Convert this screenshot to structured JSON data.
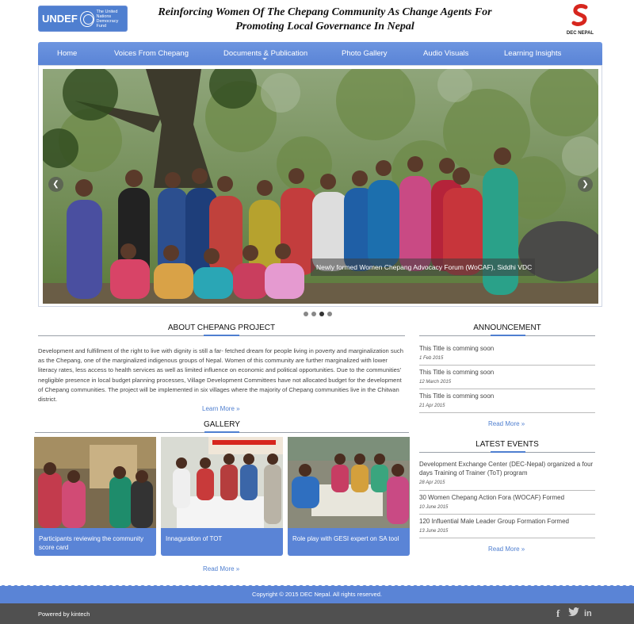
{
  "header": {
    "undef_logo_text": "UNDEF",
    "undef_logo_sub": "The United Nations Democracy Fund",
    "title_line1": "Reinforcing Women Of The Chepang Community As Change Agents For",
    "title_line2": "Promoting Local Governance In Nepal",
    "dec_logo_label": "DEC NEPAL"
  },
  "nav": {
    "items": [
      {
        "label": "Home"
      },
      {
        "label": "Voices From Chepang"
      },
      {
        "label": "Documents & Publication"
      },
      {
        "label": "Photo Gallery"
      },
      {
        "label": "Audio Visuals"
      },
      {
        "label": "Learning Insights"
      }
    ]
  },
  "slider": {
    "caption": "Newly formed Women Chepang Advocacy Forum (WoCAF), Siddhi VDC",
    "prev_icon": "chevron-left-icon",
    "next_icon": "chevron-right-icon",
    "active_dot": 3,
    "dot_count": 4
  },
  "about": {
    "heading": "ABOUT CHEPANG PROJECT",
    "body": "Development and fulfillment of the right to live with dignity is still a far- fetched dream for people living in poverty and marginalization such as the Chepang, one of the marginalized indigenous groups of Nepal. Women of this community are further marginalized with lower literacy rates, less access to health services as well as limited influence on economic and political opportunities. Due to the communities' negligible presence in local budget planning processes, Village Development Committees have not allocated budget for the development of Chepang communities. The project will be implemented in six villages where the majority of Chepang communities live in the Chitwan district.",
    "read_more": "Learn More »"
  },
  "gallery": {
    "heading": "GALLERY",
    "items": [
      {
        "caption": "Participants reviewing the community score card"
      },
      {
        "caption": "Innaguration of TOT"
      },
      {
        "caption": "Role play with GESI expert on SA tool"
      }
    ],
    "read_more": "Read More »"
  },
  "announcement": {
    "heading": "ANNOUNCEMENT",
    "items": [
      {
        "title": "This Title is comming soon",
        "date": "1 Feb 2015"
      },
      {
        "title": "This Title is comming soon",
        "date": "12 March 2015"
      },
      {
        "title": "This Title is comming soon",
        "date": "21 Apr 2015"
      }
    ],
    "read_more": "Read More »"
  },
  "events": {
    "heading": "LATEST EVENTS",
    "items": [
      {
        "title": "Development Exchange Center (DEC-Nepal) organized a four days Training of Trainer (ToT) program",
        "date": "28 Apr 2015"
      },
      {
        "title": "30 Women Chepang Action Fora (WOCAF) Formed",
        "date": "10 June 2015"
      },
      {
        "title": "120 Influential Male Leader Group Formation Formed",
        "date": "13 June 2015"
      }
    ],
    "read_more": "Read More »"
  },
  "footer": {
    "copyright": "Copyright © 2015 DEC Nepal. All rights reserved.",
    "powered": "Powered by kintech",
    "social": [
      "facebook-icon",
      "twitter-icon",
      "linkedin-icon"
    ]
  },
  "colors": {
    "accent": "#5a84d6",
    "footer_dark": "#505050",
    "link": "#4f7fd0"
  }
}
